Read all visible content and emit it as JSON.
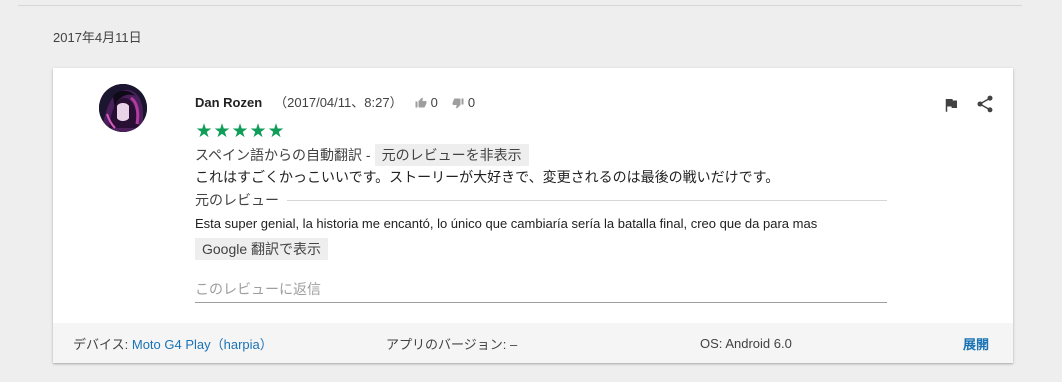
{
  "date_header": "2017年4月11日",
  "review": {
    "author": "Dan Rozen",
    "timestamp": "（2017/04/11、8:27）",
    "thumbs_up_count": "0",
    "thumbs_down_count": "0",
    "rating": 5,
    "stars": [
      "★",
      "★",
      "★",
      "★",
      "★"
    ],
    "auto_translate_label": "スペイン語からの自動翻訳 -",
    "hide_original_label": "元のレビューを非表示",
    "translated_text": "これはすごくかっこいいです。ストーリーが大好きで、変更されるのは最後の戦いだけです。",
    "original_label": "元のレビュー",
    "original_text": "Esta super genial, la historia me encantó, lo único que cambiaría sería la batalla final, creo que da para mas",
    "google_translate_label": "Google 翻訳で表示",
    "reply_placeholder": "このレビューに返信"
  },
  "footer": {
    "device_label": "デバイス:",
    "device_value": "Moto G4 Play（harpia）",
    "app_version_label": "アプリのバージョン:",
    "app_version_value": "–",
    "os_label": "OS:",
    "os_value": "Android 6.0",
    "expand_label": "展開"
  },
  "icons": [
    "thumb-up-icon",
    "thumb-down-icon",
    "flag-icon",
    "share-icon"
  ],
  "colors": {
    "star": "#0f9d58",
    "link": "#1a73b4",
    "footer_bg": "#f5f5f5"
  }
}
